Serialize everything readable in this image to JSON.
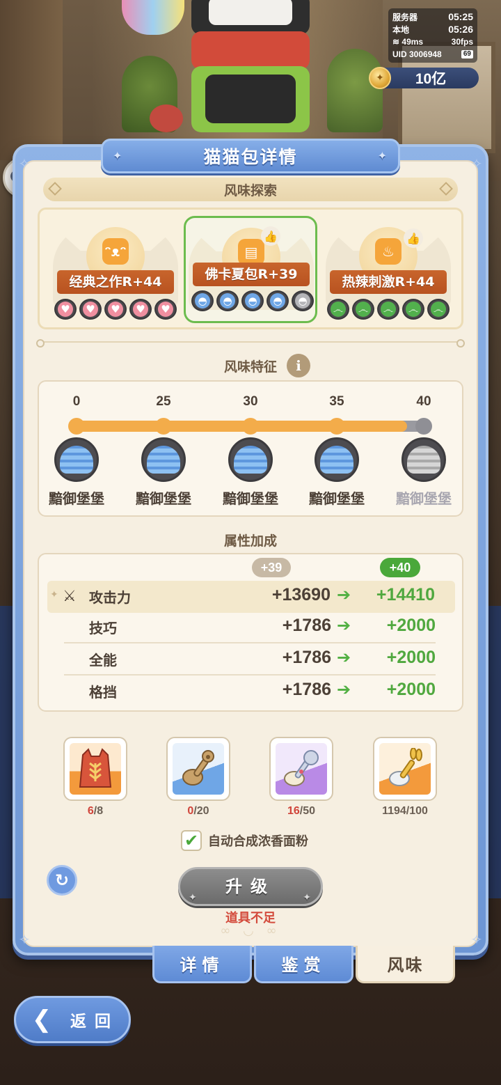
{
  "hud": {
    "server_label": "服务器",
    "server_time": "05:25",
    "local_label": "本地",
    "local_time": "05:26",
    "ping": "49ms",
    "fps": "30fps",
    "uid": "UID 3006948",
    "battery": "69"
  },
  "currency": {
    "amount": "10亿",
    "icon": "gold-coin-icon"
  },
  "panel": {
    "title": "猫猫包详情",
    "section_explore": "风味探索",
    "section_traits": "风味特征",
    "section_attrs": "属性加成"
  },
  "flavors": [
    {
      "name": "经典之作R+44",
      "icon": "cat-head-icon",
      "pip_icon": "heart-icon",
      "pips_filled": 5,
      "pips_total": 5,
      "color": "#f08fa0",
      "selected": false,
      "liked": false
    },
    {
      "name": "佛卡夏包R+39",
      "icon": "bread-icon",
      "pip_icon": "burger-icon",
      "pips_filled": 4,
      "pips_total": 5,
      "color": "#6fa7e6",
      "selected": true,
      "liked": true
    },
    {
      "name": "热辣刺激R+44",
      "icon": "flame-icon",
      "pip_icon": "swirl-icon",
      "pips_filled": 5,
      "pips_total": 5,
      "color": "#52b04d",
      "selected": false,
      "liked": true
    }
  ],
  "traits": {
    "current_level": 39,
    "max_level": 40,
    "milestones": [
      {
        "level": "0",
        "reward": "黯御堡堡",
        "unlocked": true
      },
      {
        "level": "25",
        "reward": "黯御堡堡",
        "unlocked": true
      },
      {
        "level": "30",
        "reward": "黯御堡堡",
        "unlocked": true
      },
      {
        "level": "35",
        "reward": "黯御堡堡",
        "unlocked": true
      },
      {
        "level": "40",
        "reward": "黯御堡堡",
        "unlocked": false
      }
    ]
  },
  "attributes": {
    "current_badge": "+39",
    "next_badge": "+40",
    "rows": [
      {
        "name": "攻击力",
        "current": "+13690",
        "next": "+14410",
        "highlight": true
      },
      {
        "name": "技巧",
        "current": "+1786",
        "next": "+2000",
        "highlight": false
      },
      {
        "name": "全能",
        "current": "+1786",
        "next": "+2000",
        "highlight": false
      },
      {
        "name": "格挡",
        "current": "+1786",
        "next": "+2000",
        "highlight": false
      }
    ]
  },
  "materials": [
    {
      "name": "flour-bag-icon",
      "have": "6",
      "need": "/8",
      "enough": false,
      "bg": "#f39a3c"
    },
    {
      "name": "paw-spoon-icon",
      "have": "0",
      "need": "/20",
      "enough": false,
      "bg": "#6fa6e6"
    },
    {
      "name": "cat-spoon-icon",
      "have": "16",
      "need": "/50",
      "enough": false,
      "bg": "#b98ae6"
    },
    {
      "name": "rabbit-spoon-icon",
      "have": "1194",
      "need": "/100",
      "enough": true,
      "bg": "#f39a3c"
    }
  ],
  "auto_combine": {
    "checked": true,
    "label": "自动合成浓香面粉"
  },
  "upgrade": {
    "label": "升级",
    "warning": "道具不足"
  },
  "tabs": [
    {
      "label": "详情",
      "active": false
    },
    {
      "label": "鉴赏",
      "active": false
    },
    {
      "label": "风味",
      "active": true
    }
  ],
  "back_label": "返回"
}
